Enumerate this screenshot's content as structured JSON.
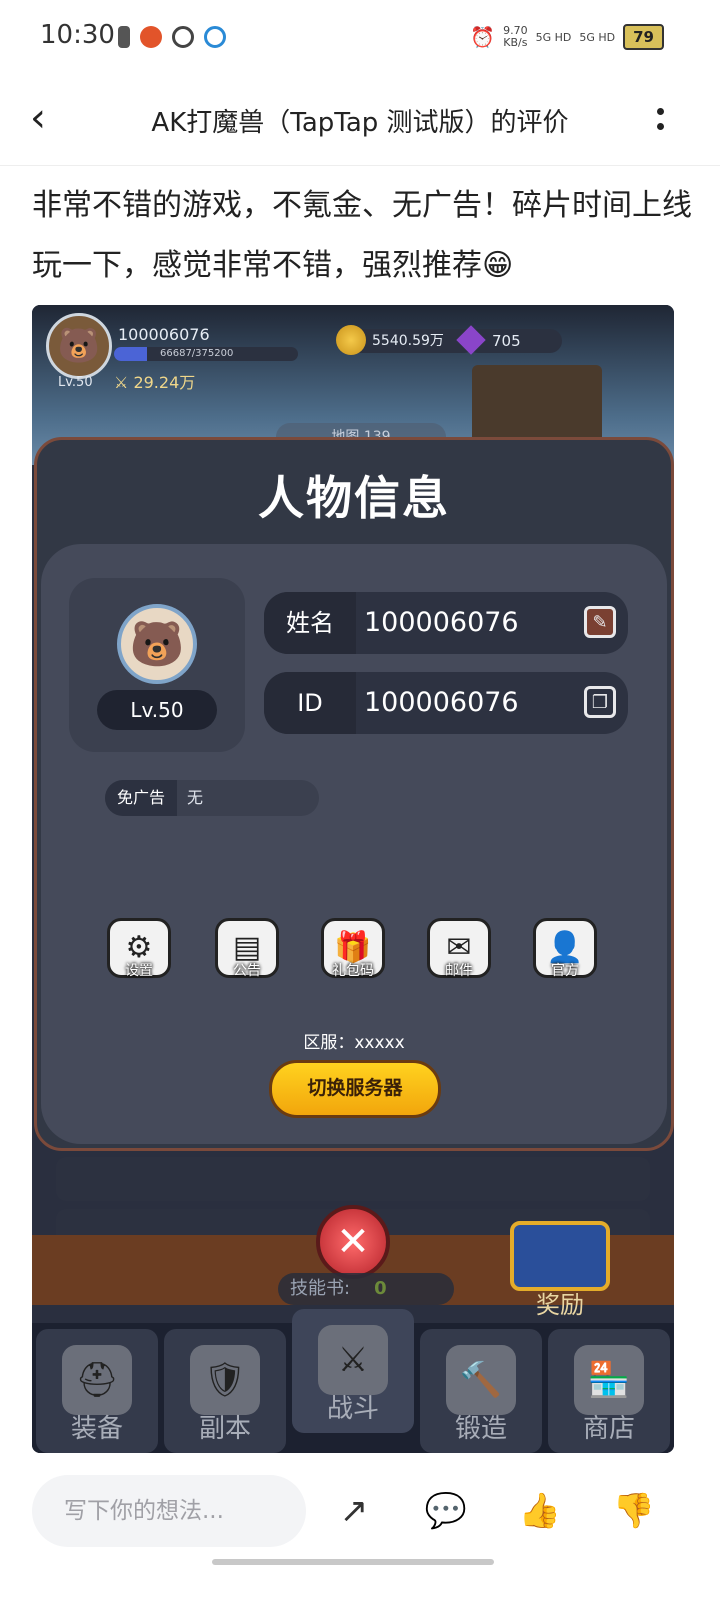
{
  "status_bar": {
    "time": "10:30",
    "net_speed": "9.70",
    "net_unit": "KB/s",
    "signal1": "5G HD",
    "signal2": "5G HD",
    "battery": "79"
  },
  "header": {
    "title": "AK打魔兽（TapTap 测试版）的评价"
  },
  "review": {
    "text": "非常不错的游戏，不氪金、无广告！碎片时间上线玩一下，感觉非常不错，强烈推荐😁"
  },
  "game": {
    "top_bar": {
      "player_id": "100006076",
      "xp_text": "66687/375200",
      "xp_progress": 0.18,
      "level": "Lv.50",
      "power": "29.24万",
      "gold": "5540.59万",
      "gems": "705",
      "map_label": "地图 139"
    },
    "modal": {
      "title": "人物信息",
      "avatar_level": "Lv.50",
      "name_label": "姓名",
      "name_value": "100006076",
      "id_label": "ID",
      "id_value": "100006076",
      "noad_label": "免广告",
      "noad_value": "无",
      "menu": [
        {
          "label": "设置",
          "icon": "gear-icon"
        },
        {
          "label": "公告",
          "icon": "notice-icon"
        },
        {
          "label": "礼包码",
          "icon": "gift-icon"
        },
        {
          "label": "邮件",
          "icon": "mail-icon"
        },
        {
          "label": "官方",
          "icon": "official-icon"
        }
      ],
      "server_text": "区服：xxxxx",
      "switch_button": "切换服务器"
    },
    "skill_book_label": "技能书:",
    "skill_book_count": "0",
    "reward_label": "奖励",
    "tabs": [
      {
        "label": "装备",
        "icon": "helmet-icon"
      },
      {
        "label": "副本",
        "icon": "sword-shield-icon"
      },
      {
        "label": "战斗",
        "icon": "crossed-swords-icon"
      },
      {
        "label": "锻造",
        "icon": "hammer-scroll-icon"
      },
      {
        "label": "商店",
        "icon": "shop-icon"
      }
    ]
  },
  "bottom_bar": {
    "placeholder": "写下你的想法..."
  }
}
